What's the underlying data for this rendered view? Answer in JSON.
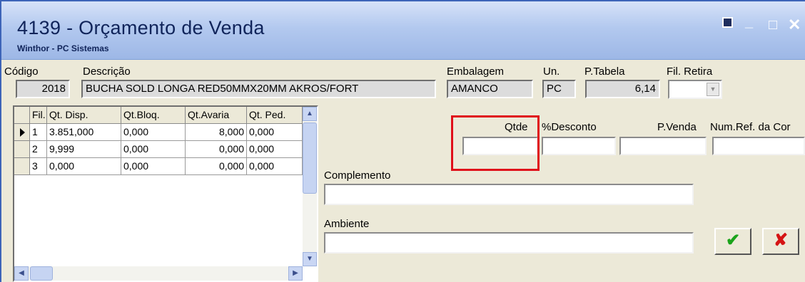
{
  "window": {
    "title": "4139 - Orçamento de Venda",
    "subtitle": "Winthor - PC Sistemas",
    "buttons": {
      "minimize": "_",
      "maximize": "□",
      "close": "✕"
    }
  },
  "fields": {
    "codigo": {
      "label": "Código",
      "value": "2018"
    },
    "descricao": {
      "label": "Descrição",
      "value": "BUCHA SOLD LONGA RED50MMX20MM AKROS/FORT"
    },
    "embalagem": {
      "label": "Embalagem",
      "value": "AMANCO"
    },
    "unidade": {
      "label": "Un.",
      "value": "PC"
    },
    "p_tabela": {
      "label": "P.Tabela",
      "value": "6,14"
    },
    "fil_retira": {
      "label": "Fil. Retira",
      "value": ""
    },
    "qtde": {
      "label": "Qtde",
      "value": ""
    },
    "desconto": {
      "label": "%Desconto",
      "value": ""
    },
    "p_venda": {
      "label": "P.Venda",
      "value": ""
    },
    "num_ref": {
      "label": "Num.Ref. da Cor",
      "value": ""
    },
    "complemento": {
      "label": "Complemento",
      "value": ""
    },
    "ambiente": {
      "label": "Ambiente",
      "value": ""
    }
  },
  "grid": {
    "columns": [
      "Fil.",
      "Qt. Disp.",
      "Qt.Bloq.",
      "Qt.Avaria",
      "Qt. Ped."
    ],
    "rows": [
      [
        "1",
        "3.851,000",
        "0,000",
        "8,000",
        "0,000"
      ],
      [
        "2",
        "9,999",
        "0,000",
        "0,000",
        "0,000"
      ],
      [
        "3",
        "0,000",
        "0,000",
        "0,000",
        "0,000"
      ]
    ]
  },
  "actions": {
    "confirm_icon": "checkmark-icon",
    "cancel_icon": "x-icon"
  },
  "colors": {
    "highlight": "#e0101a",
    "confirm": "#1aa31a",
    "cancel": "#d51414",
    "titlebar": "#b3c9ef"
  }
}
